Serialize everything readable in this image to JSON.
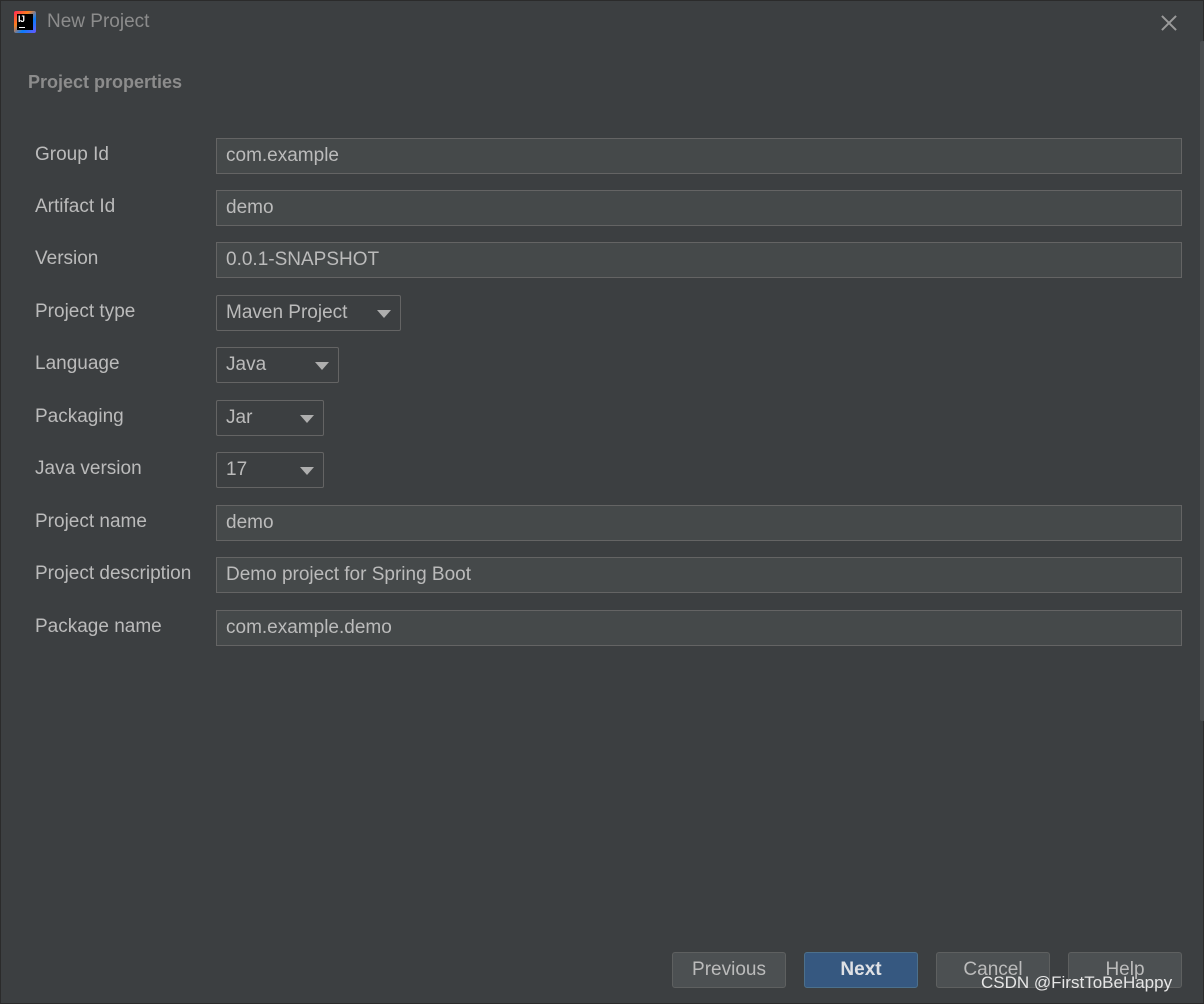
{
  "window": {
    "title": "New Project",
    "logo_icon": "intellij-idea-icon"
  },
  "section": {
    "title": "Project properties"
  },
  "fields": {
    "group_id": {
      "label": "Group Id",
      "value": "com.example"
    },
    "artifact_id": {
      "label": "Artifact Id",
      "value": "demo"
    },
    "version": {
      "label": "Version",
      "value": "0.0.1-SNAPSHOT"
    },
    "project_type": {
      "label": "Project type",
      "value": "Maven Project"
    },
    "language": {
      "label": "Language",
      "value": "Java"
    },
    "packaging": {
      "label": "Packaging",
      "value": "Jar"
    },
    "java_version": {
      "label": "Java version",
      "value": "17"
    },
    "project_name": {
      "label": "Project name",
      "value": "demo"
    },
    "project_description": {
      "label": "Project description",
      "value": "Demo project for Spring Boot"
    },
    "package_name": {
      "label": "Package name",
      "value": "com.example.demo"
    }
  },
  "buttons": {
    "previous": "Previous",
    "next": "Next",
    "cancel": "Cancel",
    "help": "Help"
  },
  "watermark": "CSDN @FirstToBeHappy",
  "colors": {
    "background": "#3c3f41",
    "input_bg": "#45494a",
    "primary_button": "#365880",
    "text": "#bbbbbb"
  }
}
